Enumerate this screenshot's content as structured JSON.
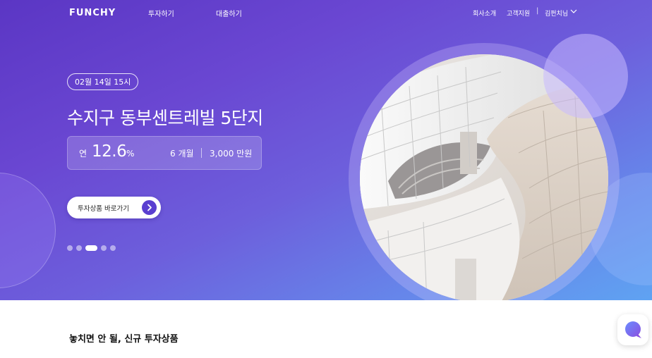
{
  "nav": {
    "logo": "FUNCHY",
    "links": [
      "투자하기",
      "대출하기"
    ],
    "company": "회사소개",
    "support": "고객지원",
    "separator": "|",
    "user": "김펀치님"
  },
  "hero": {
    "date": "02월 14일 15시",
    "title": "수지구 동부센트레빌 5단지",
    "rate_label": "연",
    "rate_value": "12.6",
    "rate_unit": "%",
    "period": "6 개월",
    "amount": "3,000 만원",
    "cta_label": "투자상품 바로가기",
    "slides_total": 5,
    "slide_active": 3
  },
  "section": {
    "title": "놓치면 안 될, 신규 투자상품"
  },
  "colors": {
    "accent": "#5a3fd0",
    "hero_start": "#5b36c4",
    "hero_end": "#5fa3f2"
  },
  "icons": [
    "chevron-down-icon",
    "arrow-right-icon",
    "chat-icon"
  ]
}
